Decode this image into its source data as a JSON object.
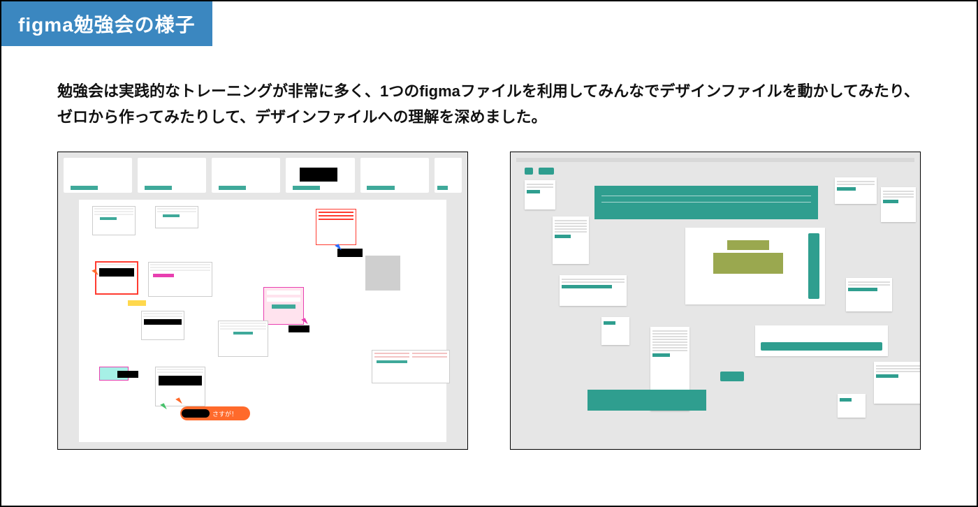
{
  "title": "figma勉強会の様子",
  "body": "勉強会は実践的なトレーニングが非常に多く、1つのfigmaファイルを利用してみんなでデザインファイルを動かしてみたり、ゼロから作ってみたりして、デザインファイルへの理解を深めました。",
  "left_screenshot": {
    "alt": "複数ユーザーが同一Figmaファイルを編集しているキャンバス",
    "comment_bubble": "さすが！"
  },
  "right_screenshot": {
    "alt": "ティールカラーのUIコンポーネントが並んだFigmaキャンバス"
  }
}
